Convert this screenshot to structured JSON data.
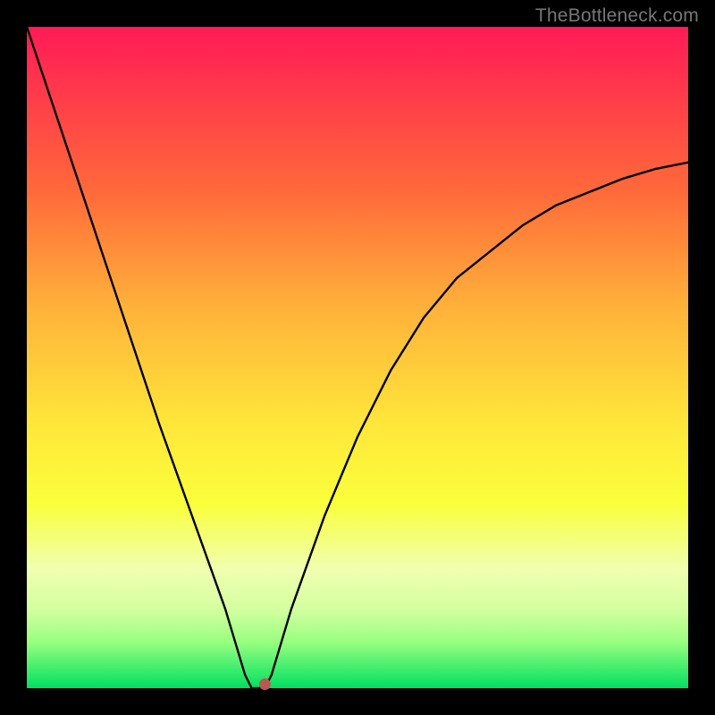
{
  "watermark_text": "TheBottleneck.com",
  "colors": {
    "background": "#000000",
    "gradient_top": "#ff1a56",
    "gradient_bottom": "#00e060",
    "curve": "#000000",
    "marker": "#bb5853",
    "watermark": "#777777"
  },
  "chart_data": {
    "type": "line",
    "title": "",
    "xlabel": "",
    "ylabel": "",
    "xlim": [
      0,
      100
    ],
    "ylim": [
      0,
      100
    ],
    "series": [
      {
        "name": "curve",
        "x": [
          0,
          5,
          10,
          15,
          20,
          25,
          30,
          33,
          34,
          35,
          36,
          37,
          40,
          45,
          50,
          55,
          60,
          65,
          70,
          75,
          80,
          85,
          90,
          95,
          100
        ],
        "y": [
          100,
          85,
          70,
          55,
          40,
          26,
          12,
          2,
          0,
          0,
          0,
          2,
          12,
          26,
          38,
          48,
          56,
          62,
          66,
          70,
          73,
          75,
          77,
          78.5,
          79.5
        ]
      }
    ],
    "marker": {
      "x": 36,
      "y": 0.6
    }
  }
}
